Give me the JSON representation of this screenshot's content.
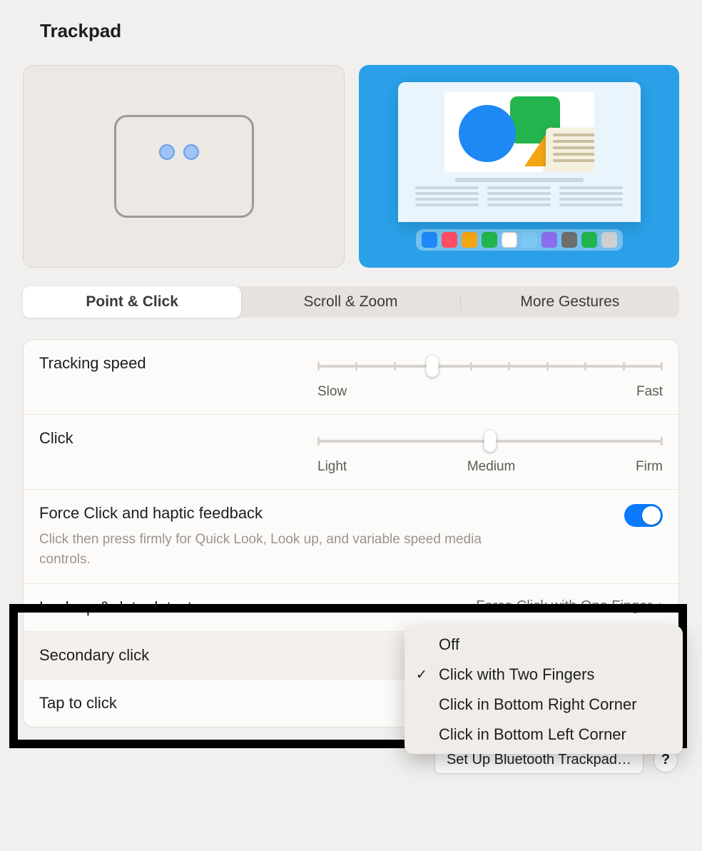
{
  "title": "Trackpad",
  "tabs": [
    {
      "label": "Point & Click",
      "active": true
    },
    {
      "label": "Scroll & Zoom",
      "active": false
    },
    {
      "label": "More Gestures",
      "active": false
    }
  ],
  "tracking_speed": {
    "label": "Tracking speed",
    "ticks": 10,
    "value_index": 3,
    "min_label": "Slow",
    "max_label": "Fast"
  },
  "click": {
    "label": "Click",
    "ticks": 3,
    "value_index": 1,
    "labels": [
      "Light",
      "Medium",
      "Firm"
    ]
  },
  "force_click": {
    "label": "Force Click and haptic feedback",
    "description": "Click then press firmly for Quick Look, Look up, and variable speed media controls.",
    "enabled": true
  },
  "lookup": {
    "label": "Look up & data detectors",
    "value": "Force Click with One Finger"
  },
  "secondary_click": {
    "label": "Secondary click",
    "selected": "Click with Two Fingers",
    "options": [
      "Off",
      "Click with Two Fingers",
      "Click in Bottom Right Corner",
      "Click in Bottom Left Corner"
    ]
  },
  "tap_to_click": {
    "label": "Tap to click"
  },
  "footer": {
    "setup_button": "Set Up Bluetooth Trackpad…",
    "help": "?"
  },
  "dock_colors": [
    "#1e88f4",
    "#ff4d62",
    "#f4a512",
    "#23b44d",
    "#ffffff",
    "#7ec8f5",
    "#8a6df0",
    "#6e6e6e",
    "#23b44d",
    "#cfcfcf"
  ]
}
